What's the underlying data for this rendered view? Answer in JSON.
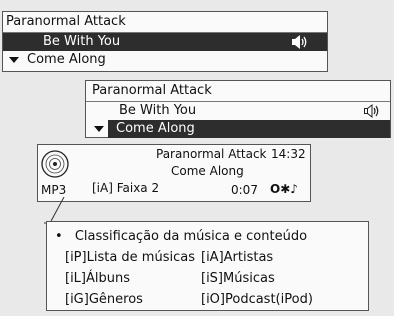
{
  "screen1": {
    "title": "Paranormal Attack",
    "items": [
      {
        "label": "Be With You",
        "selected": true
      },
      {
        "label": "Come Along",
        "selected": false
      }
    ]
  },
  "screen2": {
    "title": "Paranormal Attack",
    "items": [
      {
        "label": "Be With You",
        "selected": false
      },
      {
        "label": "Come Along",
        "selected": true
      }
    ]
  },
  "screen3": {
    "artist": "Paranormal Attack",
    "song": "Come Along",
    "clock": "14:32",
    "format": "MP3",
    "track": "[iA] Faixa 2",
    "elapsed": "0:07",
    "status_icons": "O✱♪"
  },
  "info": {
    "heading": "Classificação da música e conteúdo",
    "entries": [
      "[iP]Lista de músicas",
      "[iA]Artistas",
      "[iL]Álbuns",
      "[iS]Músicas",
      "[iG]Gêneros",
      "[iO]Podcast(iPod)"
    ]
  }
}
